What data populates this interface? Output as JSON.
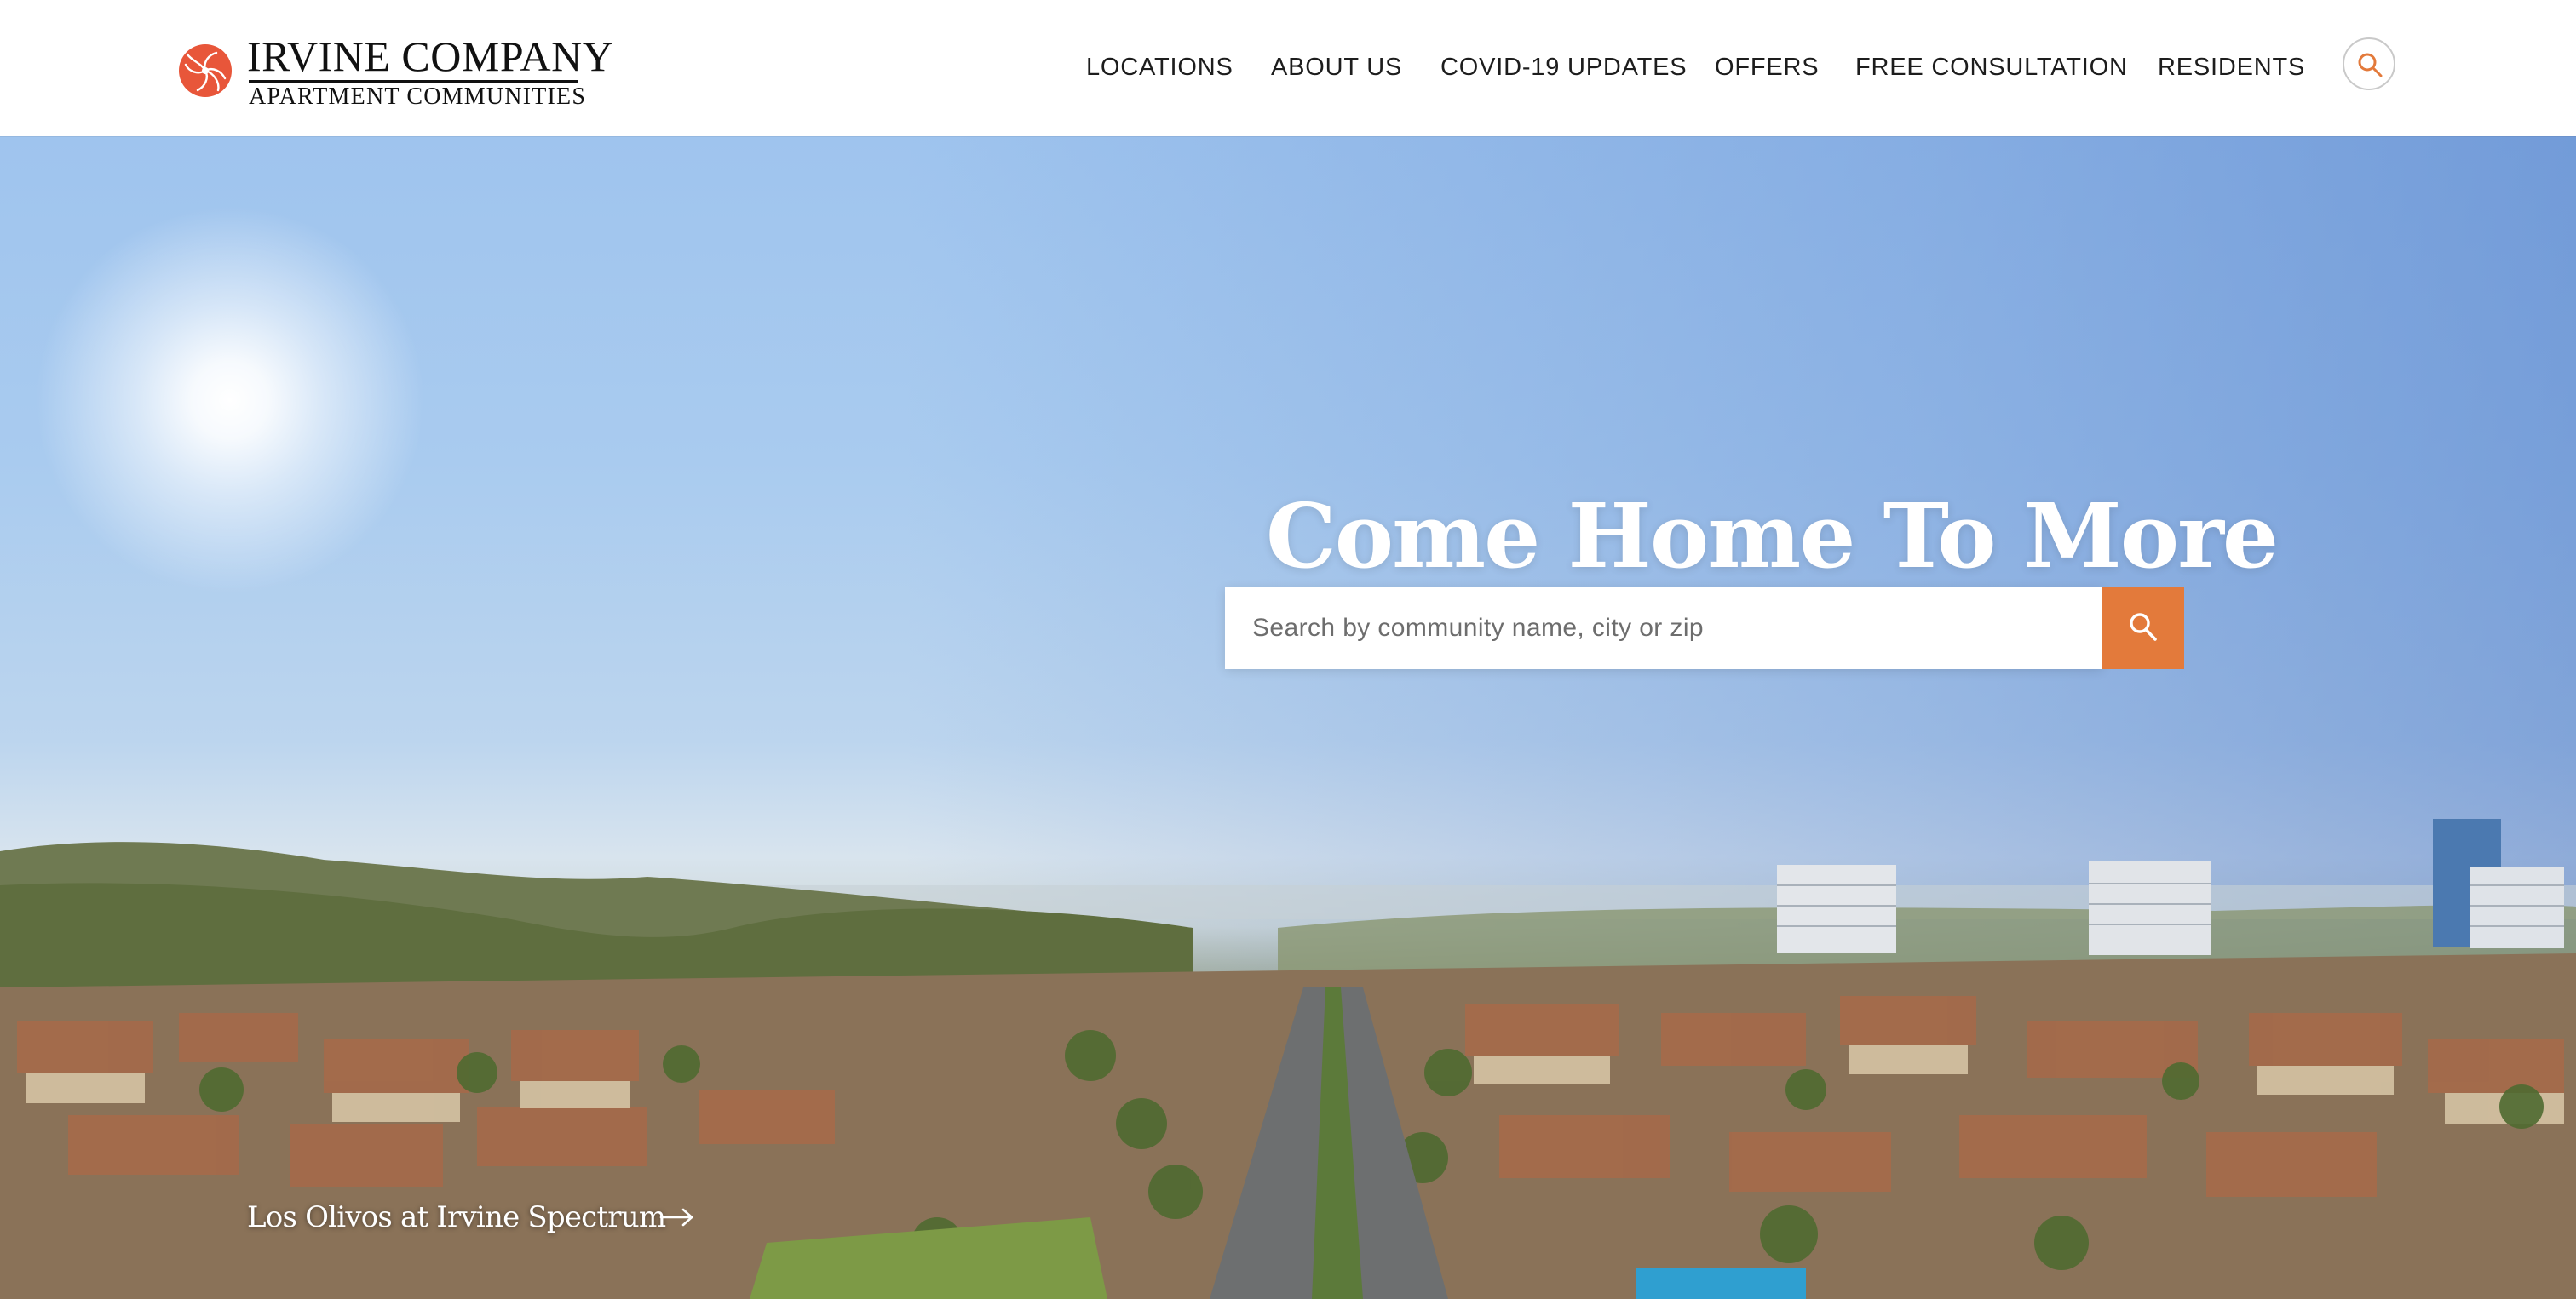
{
  "brand": {
    "name": "IRVINE COMPANY",
    "tagline": "APARTMENT COMMUNITIES",
    "accent_color": "#e8563a"
  },
  "nav": {
    "items": [
      {
        "label": "LOCATIONS"
      },
      {
        "label": "ABOUT US"
      },
      {
        "label": "COVID-19 UPDATES"
      },
      {
        "label": "OFFERS"
      },
      {
        "label": "FREE CONSULTATION"
      },
      {
        "label": "RESIDENTS"
      }
    ],
    "search_icon": "search-icon"
  },
  "hero": {
    "title": "Come Home To More",
    "search": {
      "placeholder": "Search by community name, city or zip",
      "value": "",
      "button_icon": "search-icon",
      "button_color": "#e37a3b"
    },
    "caption": {
      "label": "Los Olivos at Irvine Spectrum",
      "icon": "arrow-right-icon"
    }
  }
}
